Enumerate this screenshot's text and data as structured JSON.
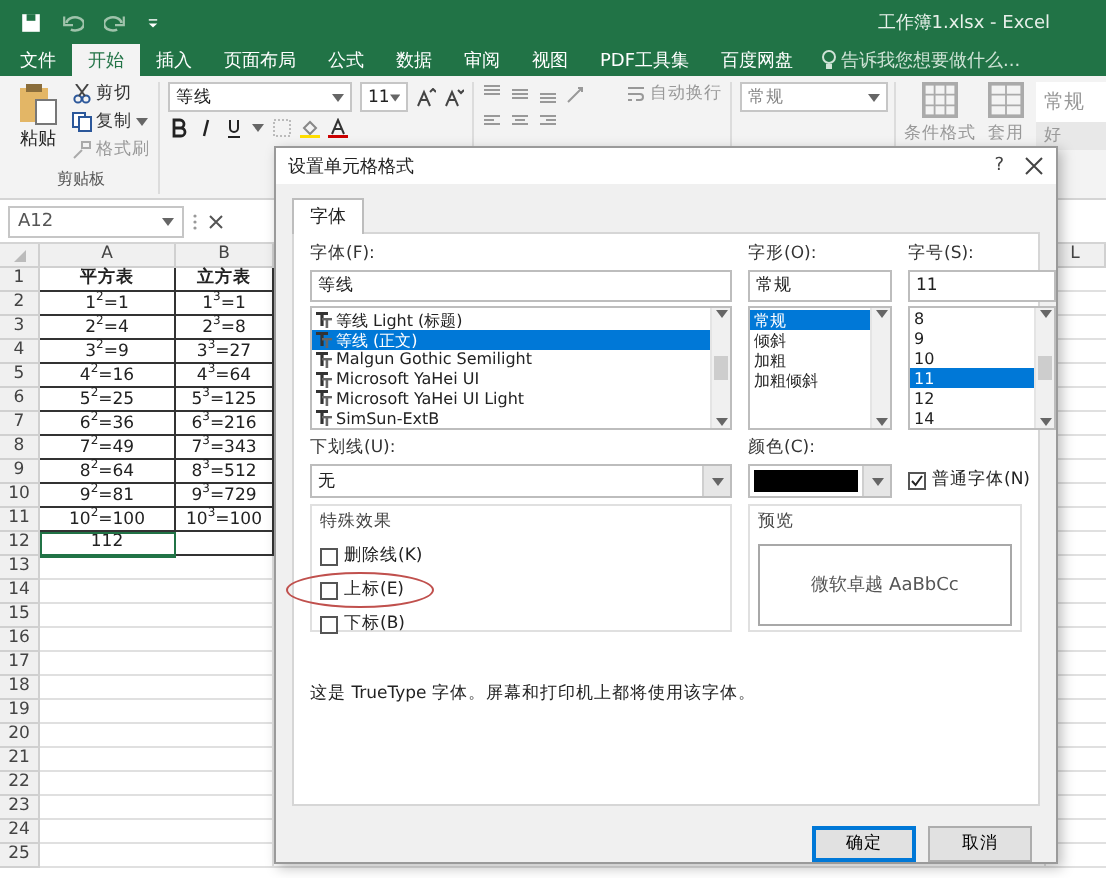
{
  "title_bar": {
    "title": "工作簿1.xlsx - Excel"
  },
  "ribbon_tabs": [
    {
      "label": "文件",
      "selected": false
    },
    {
      "label": "开始",
      "selected": true
    },
    {
      "label": "插入",
      "selected": false
    },
    {
      "label": "页面布局",
      "selected": false
    },
    {
      "label": "公式",
      "selected": false
    },
    {
      "label": "数据",
      "selected": false
    },
    {
      "label": "审阅",
      "selected": false
    },
    {
      "label": "视图",
      "selected": false
    },
    {
      "label": "PDF工具集",
      "selected": false
    },
    {
      "label": "百度网盘",
      "selected": false
    }
  ],
  "tell_me": {
    "placeholder": "告诉我您想要做什么..."
  },
  "ribbon": {
    "clipboard": {
      "paste": "粘贴",
      "cut": "剪切",
      "copy": "复制",
      "format_painter": "格式刷",
      "group": "剪贴板"
    },
    "font": {
      "name": "等线",
      "size": "11"
    },
    "alignment": {
      "wrap": "自动换行"
    },
    "number": {
      "format": "常规"
    },
    "styles": {
      "conditional": "条件格式",
      "table": "套用",
      "gallery": [
        "常规",
        "好"
      ]
    }
  },
  "name_box": "A12",
  "sheet": {
    "columns": [
      "A",
      "B",
      "L"
    ],
    "rows": [
      {
        "number": "1",
        "cells": [
          {
            "text": "平方表",
            "selected": false
          },
          {
            "text": "立方表",
            "selected": false
          }
        ]
      },
      {
        "number": "2",
        "cells": [
          {
            "text": "1$^{2}$=1",
            "selected": false
          },
          {
            "text": "1$^{3}$=1",
            "selected": false
          }
        ]
      },
      {
        "number": "3",
        "cells": [
          {
            "text": "2$^{2}$=4",
            "selected": false
          },
          {
            "text": "2$^{3}$=8",
            "selected": false
          }
        ]
      },
      {
        "number": "4",
        "cells": [
          {
            "text": "3$^{2}$=9",
            "selected": false
          },
          {
            "text": "3$^{3}$=27",
            "selected": false
          }
        ]
      },
      {
        "number": "5",
        "cells": [
          {
            "text": "4$^{2}$=16",
            "selected": false
          },
          {
            "text": "4$^{3}$=64",
            "selected": false
          }
        ]
      },
      {
        "number": "6",
        "cells": [
          {
            "text": "5$^{2}$=25",
            "selected": false
          },
          {
            "text": "5$^{3}$=125",
            "selected": false
          }
        ]
      },
      {
        "number": "7",
        "cells": [
          {
            "text": "6$^{2}$=36",
            "selected": false
          },
          {
            "text": "6$^{3}$=216",
            "selected": false
          }
        ]
      },
      {
        "number": "8",
        "cells": [
          {
            "text": "7$^{2}$=49",
            "selected": false
          },
          {
            "text": "7$^{3}$=343",
            "selected": false
          }
        ]
      },
      {
        "number": "9",
        "cells": [
          {
            "text": "8$^{2}$=64",
            "selected": false
          },
          {
            "text": "8$^{3}$=512",
            "selected": false
          }
        ]
      },
      {
        "number": "10",
        "cells": [
          {
            "text": "9$^{2}$=81",
            "selected": false
          },
          {
            "text": "9$^{3}$=729",
            "selected": false
          }
        ]
      },
      {
        "number": "11",
        "cells": [
          {
            "text": "10$^{2}$=100",
            "selected": false
          },
          {
            "text": "10$^{3}$=100",
            "selected": false
          }
        ]
      },
      {
        "number": "12",
        "cells": [
          {
            "text": "112",
            "selected": true
          },
          {
            "selected": false
          }
        ]
      },
      {
        "number": "13"
      },
      {
        "number": "14"
      },
      {
        "number": "15"
      },
      {
        "number": "16"
      },
      {
        "number": "17"
      },
      {
        "number": "18"
      },
      {
        "number": "19"
      },
      {
        "number": "20"
      },
      {
        "number": "21"
      },
      {
        "number": "22"
      },
      {
        "number": "23"
      },
      {
        "number": "24"
      },
      {
        "number": "25"
      }
    ]
  },
  "dialog": {
    "title": "设置单元格格式",
    "help": "?",
    "tabs": [
      {
        "label": "字体",
        "selected": true
      }
    ],
    "font": {
      "label": "字体(F):",
      "value": "等线",
      "options": [
        {
          "label": "等线 Light (标题)",
          "selected": false
        },
        {
          "label": "等线 (正文)",
          "selected": true
        },
        {
          "label": "Malgun Gothic Semilight",
          "selected": false
        },
        {
          "label": "Microsoft YaHei UI",
          "selected": false
        },
        {
          "label": "Microsoft YaHei UI Light",
          "selected": false
        },
        {
          "label": "SimSun-ExtB",
          "selected": false
        }
      ]
    },
    "style": {
      "label": "字形(O):",
      "value": "常规",
      "options": [
        {
          "label": "常规",
          "selected": true
        },
        {
          "label": "倾斜",
          "selected": false
        },
        {
          "label": "加粗",
          "selected": false
        },
        {
          "label": "加粗倾斜",
          "selected": false
        }
      ]
    },
    "size": {
      "label": "字号(S):",
      "value": "11",
      "options": [
        {
          "label": "8",
          "selected": false
        },
        {
          "label": "9",
          "selected": false
        },
        {
          "label": "10",
          "selected": false
        },
        {
          "label": "11",
          "selected": true
        },
        {
          "label": "12",
          "selected": false
        },
        {
          "label": "14",
          "selected": false
        }
      ]
    },
    "underline": {
      "label": "下划线(U):",
      "value": "无"
    },
    "color": {
      "label": "颜色(C):"
    },
    "normal_font": {
      "label": "普通字体(N)",
      "checked": true
    },
    "effects": {
      "title": "特殊效果",
      "items": [
        {
          "label": "删除线(K)",
          "checked": false
        },
        {
          "label": "上标(E)",
          "checked": false
        },
        {
          "label": "下标(B)",
          "checked": false
        }
      ]
    },
    "preview": {
      "title": "预览",
      "sample": "微软卓越  AaBbCc"
    },
    "note": "这是 TrueType 字体。屏幕和打印机上都将使用该字体。",
    "buttons": [
      {
        "label": "确定",
        "kind": "default"
      },
      {
        "label": "取消",
        "kind": "normal"
      }
    ]
  }
}
